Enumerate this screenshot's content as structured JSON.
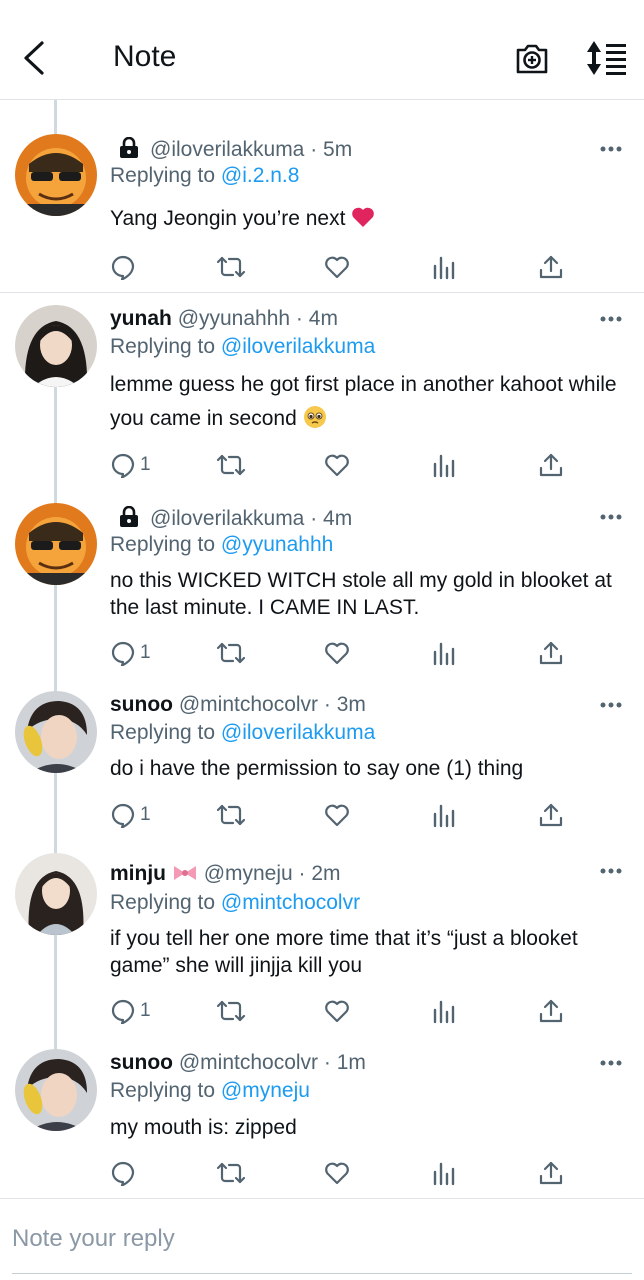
{
  "header": {
    "title": "Note"
  },
  "colors": {
    "accent": "#1d9bf0",
    "muted": "#536471",
    "text": "#0f1419",
    "heart_emoji": "#e0245e"
  },
  "tweets": [
    {
      "name": "",
      "handle": "@iloverilakkuma",
      "time": "5m",
      "locked": true,
      "replying_label": "Replying to",
      "replying_to": "@i.2.n.8",
      "body": "Yang Jeongin you’re next",
      "emoji": "heart",
      "reply_count": ""
    },
    {
      "name": "yunah",
      "handle": "@yyunahhh",
      "time": "4m",
      "locked": false,
      "replying_label": "Replying to",
      "replying_to": "@iloverilakkuma",
      "body": "lemme guess he got first place in another kahoot while you came in second",
      "emoji": "pleading-face",
      "reply_count": "1"
    },
    {
      "name": "",
      "handle": "@iloverilakkuma",
      "time": "4m",
      "locked": true,
      "replying_label": "Replying to",
      "replying_to": "@yyunahhh",
      "body": "no this WICKED WITCH stole all my gold in blooket at the last minute. I CAME IN LAST.",
      "emoji": "",
      "reply_count": "1"
    },
    {
      "name": "sunoo",
      "handle": "@mintchocolvr",
      "time": "3m",
      "locked": false,
      "replying_label": "Replying to",
      "replying_to": "@iloverilakkuma",
      "body": "do i have the permission to say one (1) thing",
      "emoji": "",
      "reply_count": "1"
    },
    {
      "name": "minju",
      "name_emoji": "ribbon",
      "handle": "@myneju",
      "time": "2m",
      "locked": false,
      "replying_label": "Replying to",
      "replying_to": "@mintchocolvr",
      "body": "if you tell her one more time that it’s “just a blooket game” she will jinjja kill you",
      "emoji": "",
      "reply_count": "1"
    },
    {
      "name": "sunoo",
      "handle": "@mintchocolvr",
      "time": "1m",
      "locked": false,
      "replying_label": "Replying to",
      "replying_to": "@myneju",
      "body": "my mouth is: zipped",
      "emoji": "",
      "reply_count": ""
    }
  ],
  "compose": {
    "placeholder": "Note your reply"
  },
  "icons": [
    "back-arrow-icon",
    "camera-add-icon",
    "sort-icon",
    "lock-icon",
    "more-icon",
    "reply-icon",
    "retweet-icon",
    "like-icon",
    "stats-icon",
    "share-icon"
  ]
}
